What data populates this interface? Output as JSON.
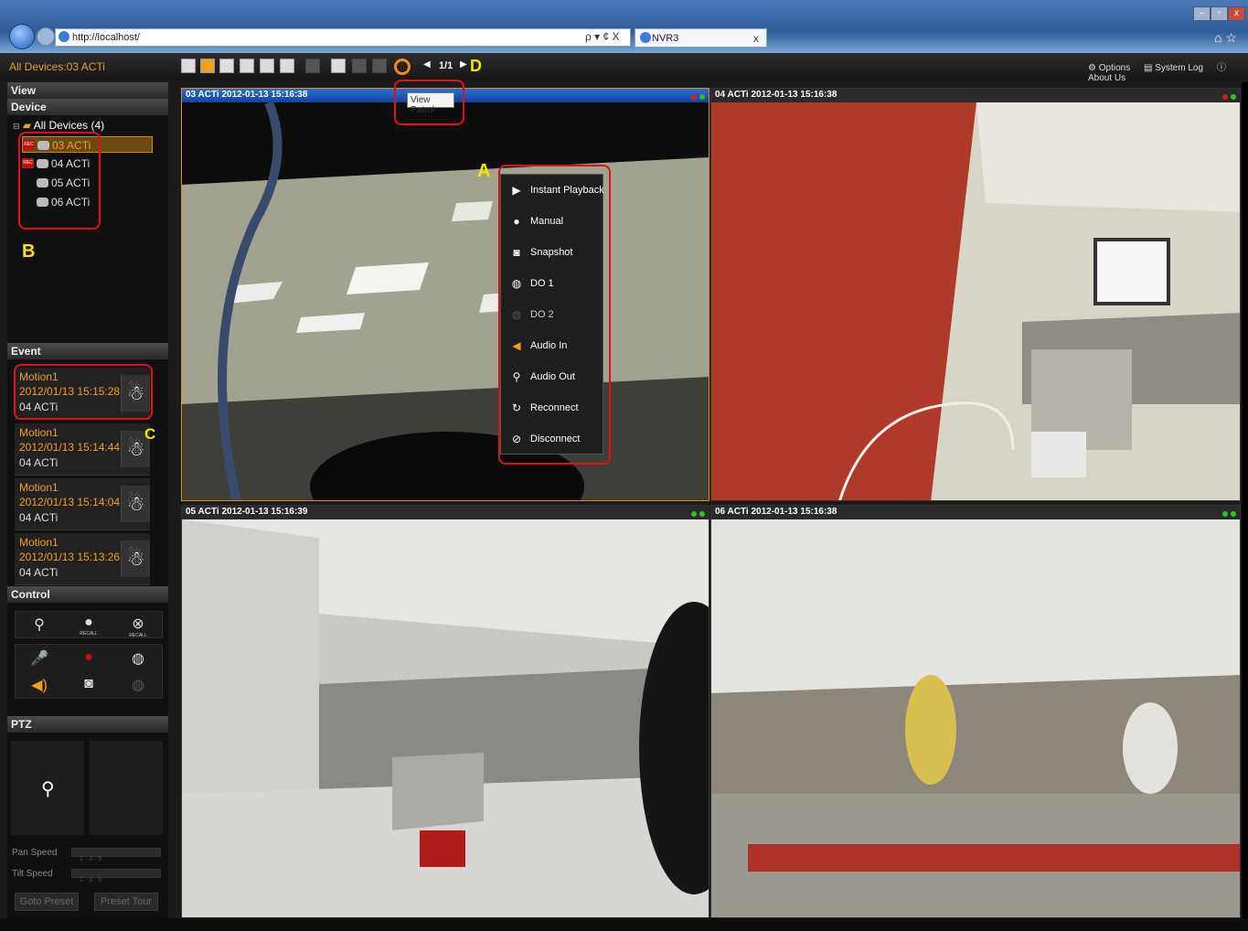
{
  "browser": {
    "url": "http://localhost/",
    "tab_title": "NVR3",
    "addr_controls": "ρ ▾ ¢ X",
    "tab_close": "x"
  },
  "app": {
    "title": "All Devices:03 ACTi",
    "page": "1/1",
    "tooltip": "View Patrol",
    "links": {
      "options": "Options",
      "system_log": "System Log",
      "about": "About Us"
    }
  },
  "annotations": {
    "a": "A",
    "b": "B",
    "c": "C",
    "d": "D"
  },
  "sidebar": {
    "view_header": "View",
    "device_header": "Device",
    "tree_root": "All Devices (4)",
    "devices": [
      {
        "label": "03  ACTi",
        "rec": "REC",
        "selected": true
      },
      {
        "label": "04  ACTi",
        "rec": "REC",
        "selected": false
      },
      {
        "label": "05  ACTi",
        "rec": "",
        "selected": false
      },
      {
        "label": "06  ACTi",
        "rec": "",
        "selected": false
      }
    ],
    "event_header": "Event",
    "events": [
      {
        "type": "Motion1",
        "time": "2012/01/13 15:15:28",
        "device": "04 ACTi"
      },
      {
        "type": "Motion1",
        "time": "2012/01/13 15:14:44",
        "device": "04 ACTi"
      },
      {
        "type": "Motion1",
        "time": "2012/01/13 15:14:04",
        "device": "04 ACTi"
      },
      {
        "type": "Motion1",
        "time": "2012/01/13 15:13:26",
        "device": "04 ACTi"
      }
    ],
    "control_header": "Control",
    "control": {
      "recall": "RECALL"
    },
    "ptz_header": "PTZ",
    "ptz": {
      "pan_speed": "Pan Speed",
      "tilt_speed": "Tilt Speed",
      "goto_preset": "Goto Preset",
      "preset_tour": "Preset Tour",
      "speed_ticks": "1 · 3 · 5"
    }
  },
  "cameras": [
    {
      "title": "03 ACTi  2012-01-13 15:16:38",
      "active": true
    },
    {
      "title": "04 ACTi  2012-01-13 15:16:38",
      "active": false
    },
    {
      "title": "05 ACTi  2012-01-13 15:16:39",
      "active": false
    },
    {
      "title": "06 ACTi  2012-01-13 15:16:38",
      "active": false
    }
  ],
  "context_menu": [
    {
      "label": "Instant Playback",
      "icon": "play-icon"
    },
    {
      "label": "Manual",
      "icon": "record-icon"
    },
    {
      "label": "Snapshot",
      "icon": "camera-icon"
    },
    {
      "label": "DO 1",
      "icon": "do-icon"
    },
    {
      "label": "DO 2",
      "icon": "do-icon"
    },
    {
      "label": "Audio In",
      "icon": "speaker-icon"
    },
    {
      "label": "Audio Out",
      "icon": "microphone-icon"
    },
    {
      "label": "Reconnect",
      "icon": "reconnect-icon"
    },
    {
      "label": "Disconnect",
      "icon": "disconnect-icon"
    }
  ],
  "colors": {
    "accent": "#f0a020",
    "annotation": "#e0101a",
    "annotation_label": "#f5e400",
    "active_bar": "#2b6fd0"
  }
}
